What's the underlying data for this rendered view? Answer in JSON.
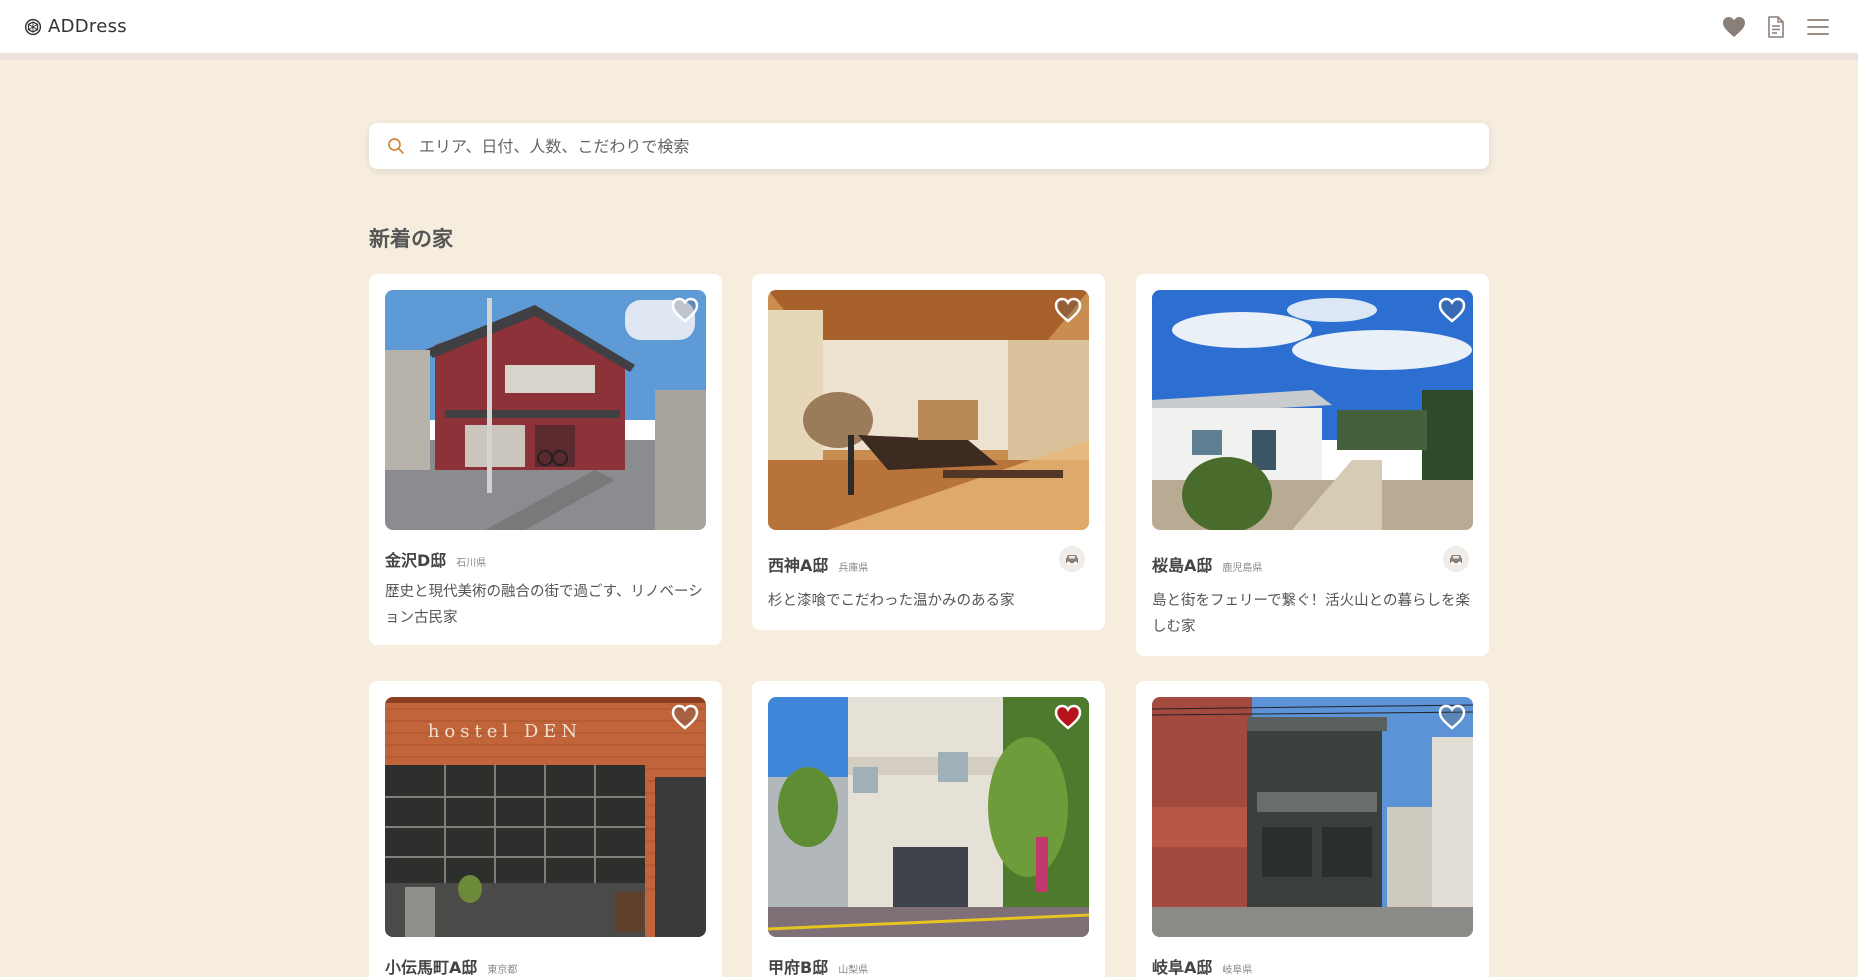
{
  "header": {
    "logo_text": "ADDress",
    "icons": [
      "heart-icon",
      "document-icon",
      "menu-icon"
    ]
  },
  "search": {
    "placeholder": "エリア、日付、人数、こだわりで検索"
  },
  "section": {
    "title": "新着の家"
  },
  "colors": {
    "background": "#f6eddf",
    "favorite_active": "#b5121b",
    "favorite_inactive": "#ffffff",
    "search_icon": "#d0893a"
  },
  "cards": [
    {
      "name": "金沢D邸",
      "prefecture": "石川県",
      "description": "歴史と現代美術の融合の街で過ごす、リノベーション古民家",
      "favorited": false,
      "car": false
    },
    {
      "name": "西神A邸",
      "prefecture": "兵庫県",
      "description": "杉と漆喰でこだわった温かみのある家",
      "favorited": false,
      "car": true
    },
    {
      "name": "桜島A邸",
      "prefecture": "鹿児島県",
      "description": "島と街をフェリーで繋ぐ！活火山との暮らしを楽しむ家",
      "favorited": false,
      "car": true
    },
    {
      "name": "小伝馬町A邸",
      "prefecture": "東京都",
      "description": "",
      "favorited": false,
      "car": false,
      "photo_text": "hostel DEN"
    },
    {
      "name": "甲府B邸",
      "prefecture": "山梨県",
      "description": "",
      "favorited": true,
      "car": false
    },
    {
      "name": "岐阜A邸",
      "prefecture": "岐阜県",
      "description": "",
      "favorited": false,
      "car": false
    }
  ]
}
